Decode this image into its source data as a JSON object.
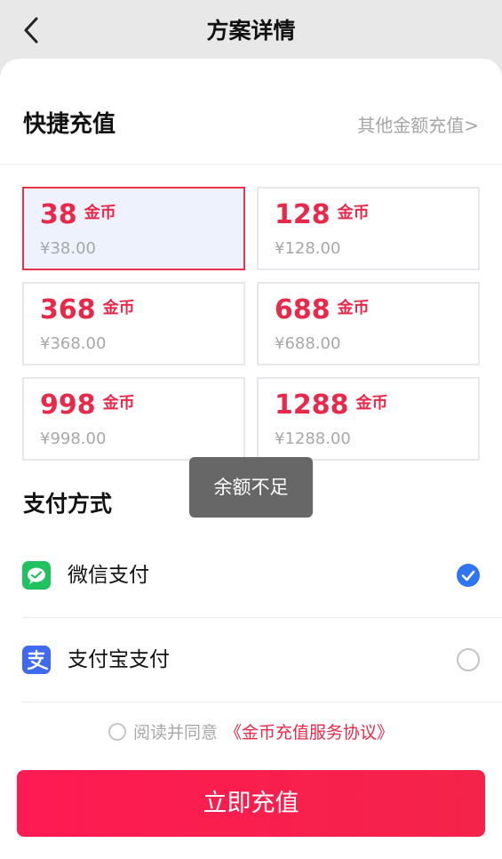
{
  "header": {
    "title": "方案详情",
    "back_icon": "chevron-left-icon"
  },
  "quick": {
    "title": "快捷充值",
    "other_amount_label": "其他金额充值>"
  },
  "plans": [
    {
      "coins": "38",
      "unit": "金币",
      "price": "¥38.00",
      "selected": true
    },
    {
      "coins": "128",
      "unit": "金币",
      "price": "¥128.00",
      "selected": false
    },
    {
      "coins": "368",
      "unit": "金币",
      "price": "¥368.00",
      "selected": false
    },
    {
      "coins": "688",
      "unit": "金币",
      "price": "¥688.00",
      "selected": false
    },
    {
      "coins": "998",
      "unit": "金币",
      "price": "¥998.00",
      "selected": false
    },
    {
      "coins": "1288",
      "unit": "金币",
      "price": "¥1288.00",
      "selected": false
    }
  ],
  "toast": {
    "text": "余额不足"
  },
  "payment": {
    "title": "支付方式",
    "methods": [
      {
        "label": "微信支付",
        "icon": "wechat-pay-icon",
        "selected": true
      },
      {
        "label": "支付宝支付",
        "icon": "alipay-icon",
        "selected": false
      }
    ]
  },
  "agreement": {
    "prefix": "阅读并同意",
    "link": "《金币充值服务协议》",
    "checked": false
  },
  "footer": {
    "button_label": "立即充值"
  },
  "colors": {
    "accent_red": "#e8294a",
    "check_blue": "#2f74f0",
    "wechat_green": "#22c160",
    "alipay_blue": "#3f6af0"
  }
}
